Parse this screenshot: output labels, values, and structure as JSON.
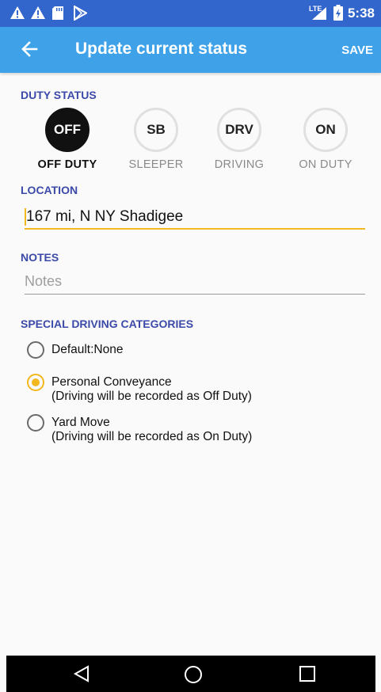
{
  "status_bar": {
    "time": "5:38",
    "network": "LTE",
    "icons": [
      "warning-icon",
      "warning-icon",
      "sd-card-icon",
      "play-store-icon",
      "signal-icon",
      "battery-icon"
    ]
  },
  "app_bar": {
    "title": "Update current status",
    "save_label": "SAVE",
    "back_icon": "arrow-left-icon",
    "color": "#3fa2e8"
  },
  "duty_status": {
    "section_label": "DUTY STATUS",
    "options": [
      {
        "code": "OFF",
        "label": "OFF DUTY",
        "selected": true
      },
      {
        "code": "SB",
        "label": "SLEEPER",
        "selected": false
      },
      {
        "code": "DRV",
        "label": "DRIVING",
        "selected": false
      },
      {
        "code": "ON",
        "label": "ON DUTY",
        "selected": false
      }
    ]
  },
  "location": {
    "section_label": "LOCATION",
    "value": "167 mi, N NY Shadigee"
  },
  "notes": {
    "section_label": "NOTES",
    "placeholder": "Notes",
    "value": ""
  },
  "special_driving": {
    "section_label": "SPECIAL DRIVING CATEGORIES",
    "options": [
      {
        "label": "Default:None",
        "sublabel": "",
        "selected": false
      },
      {
        "label": "Personal Conveyance",
        "sublabel": "(Driving will be recorded as Off Duty)",
        "selected": true
      },
      {
        "label": "Yard Move",
        "sublabel": "(Driving will be recorded as On Duty)",
        "selected": false
      }
    ]
  },
  "nav_bar": {
    "icons": [
      "back-triangle-icon",
      "home-circle-icon",
      "recents-square-icon"
    ]
  },
  "colors": {
    "status_bar": "#3366cc",
    "accent": "#f3b81f",
    "section_label": "#3b4aa8"
  }
}
